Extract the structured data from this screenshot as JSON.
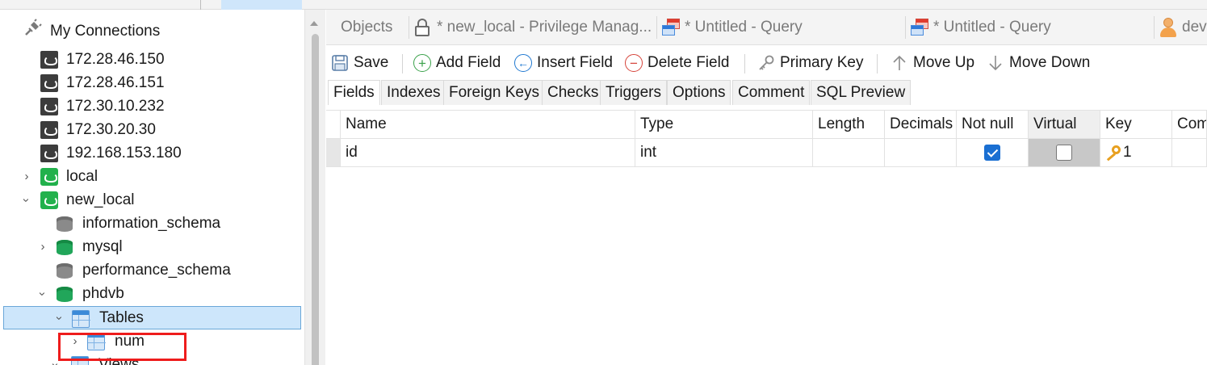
{
  "sidebar": {
    "root_label": "My Connections",
    "connections": [
      {
        "label": "172.28.46.150"
      },
      {
        "label": "172.28.46.151"
      },
      {
        "label": "172.30.10.232"
      },
      {
        "label": "172.30.20.30"
      },
      {
        "label": "192.168.153.180"
      }
    ],
    "local_label": "local",
    "new_local_label": "new_local",
    "databases": [
      {
        "label": "information_schema"
      },
      {
        "label": "mysql"
      },
      {
        "label": "performance_schema"
      },
      {
        "label": "phdvb"
      }
    ],
    "tables_label": "Tables",
    "table_num_label": "num",
    "views_label": "Views"
  },
  "doc_tabs": [
    {
      "label": "Objects"
    },
    {
      "label": "* new_local - Privilege Manag..."
    },
    {
      "label": "* Untitled - Query"
    },
    {
      "label": "* Untitled - Query"
    },
    {
      "label": "dev"
    }
  ],
  "toolbar": {
    "save": "Save",
    "add_field": "Add Field",
    "insert_field": "Insert Field",
    "delete_field": "Delete Field",
    "primary_key": "Primary Key",
    "move_up": "Move Up",
    "move_down": "Move Down"
  },
  "sub_tabs": [
    {
      "label": "Fields"
    },
    {
      "label": "Indexes"
    },
    {
      "label": "Foreign Keys"
    },
    {
      "label": "Checks"
    },
    {
      "label": "Triggers"
    },
    {
      "label": "Options"
    },
    {
      "label": "Comment"
    },
    {
      "label": "SQL Preview"
    }
  ],
  "grid": {
    "columns": [
      "Name",
      "Type",
      "Length",
      "Decimals",
      "Not null",
      "Virtual",
      "Key",
      "Comment"
    ],
    "rows": [
      {
        "name": "id",
        "type": "int",
        "length": "",
        "decimals": "",
        "not_null": true,
        "virtual": false,
        "key": "1",
        "comment": ""
      }
    ]
  },
  "colors": {
    "selection": "#cde6fb",
    "accent_blue": "#1a6fd2",
    "highlight_red": "#ee1c1c",
    "mysql_green": "#22b14c"
  }
}
